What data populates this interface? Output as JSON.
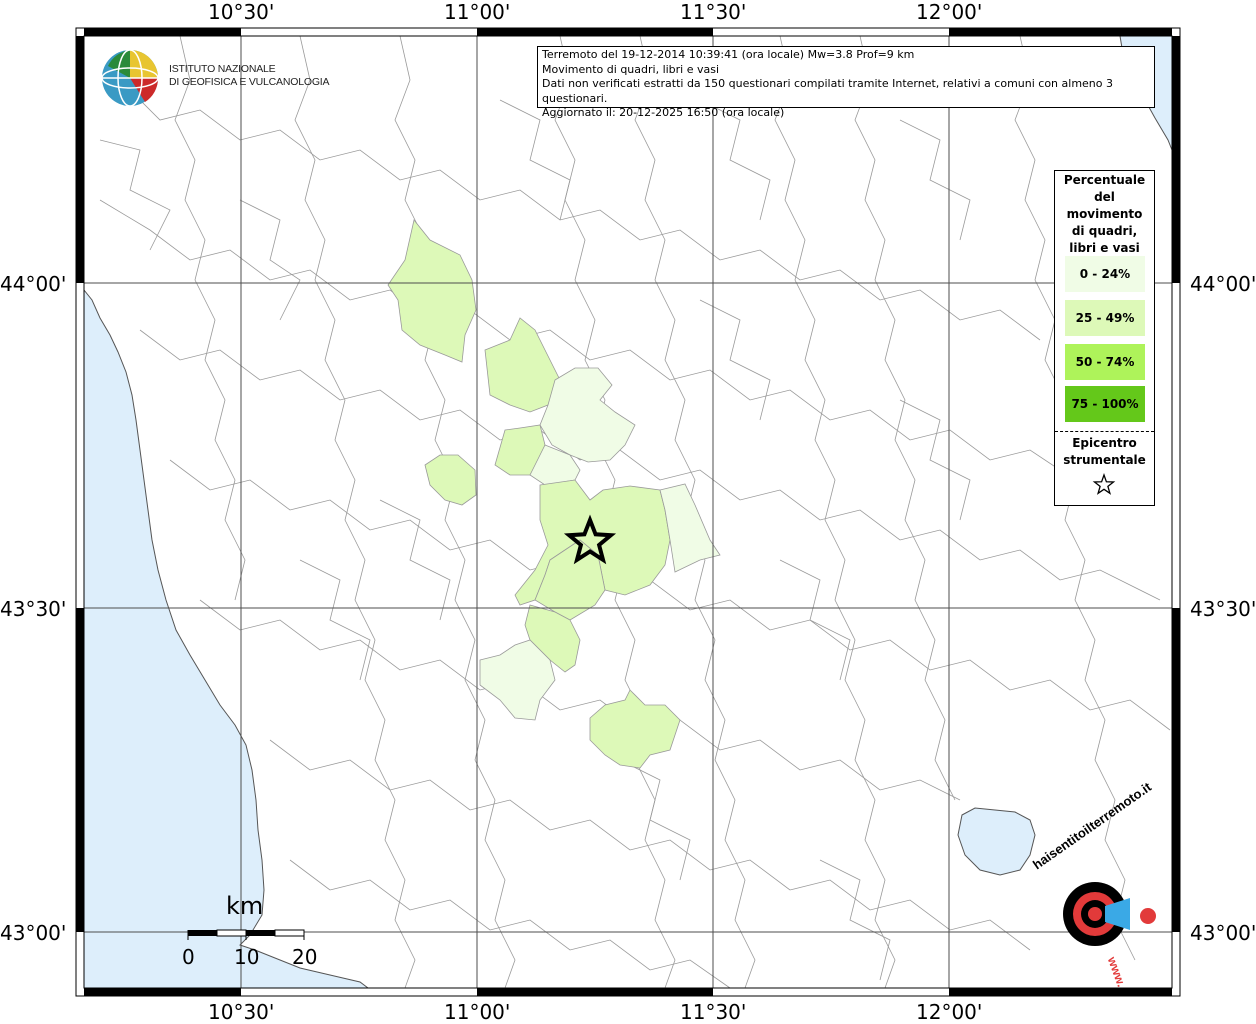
{
  "map": {
    "lon_ticks": [
      "10°30'",
      "11°00'",
      "11°30'",
      "12°00'"
    ],
    "lat_ticks": [
      "44°00'",
      "43°30'",
      "43°00'"
    ]
  },
  "info": {
    "line1": "Terremoto del 19-12-2014 10:39:41 (ora locale) Mw=3.8 Prof=9 km",
    "line2": "Movimento di quadri, libri e vasi",
    "line3": "Dati non verificati estratti da 150 questionari compilati tramite Internet, relativi a comuni con almeno 3 questionari.",
    "line4": "Aggiornato il: 20-12-2025 16:50 (ora locale)"
  },
  "logo": {
    "line1": "ISTITUTO NAZIONALE",
    "line2": "DI GEOFISICA E VULCANOLOGIA"
  },
  "legend": {
    "title_lines": [
      "Percentuale",
      "del",
      "movimento",
      "di quadri,",
      "libri e vasi"
    ],
    "classes": [
      {
        "label": "0 - 24%",
        "color": "#f0fce6"
      },
      {
        "label": "25 - 49%",
        "color": "#ddf9b8"
      },
      {
        "label": "50 - 74%",
        "color": "#aef35a"
      },
      {
        "label": "75 - 100%",
        "color": "#64c81a"
      }
    ],
    "epicenter_lines": [
      "Epicentro",
      "strumentale"
    ]
  },
  "scale": {
    "unit": "km",
    "labels": [
      "0",
      "10",
      "20"
    ]
  },
  "haisentito": {
    "text": "haisentitoilterremoto.it",
    "url_text": "www."
  },
  "colors": {
    "sea": "#ddeefb",
    "boundary": "#9a9a9a",
    "grid": "#4d4d4d"
  }
}
